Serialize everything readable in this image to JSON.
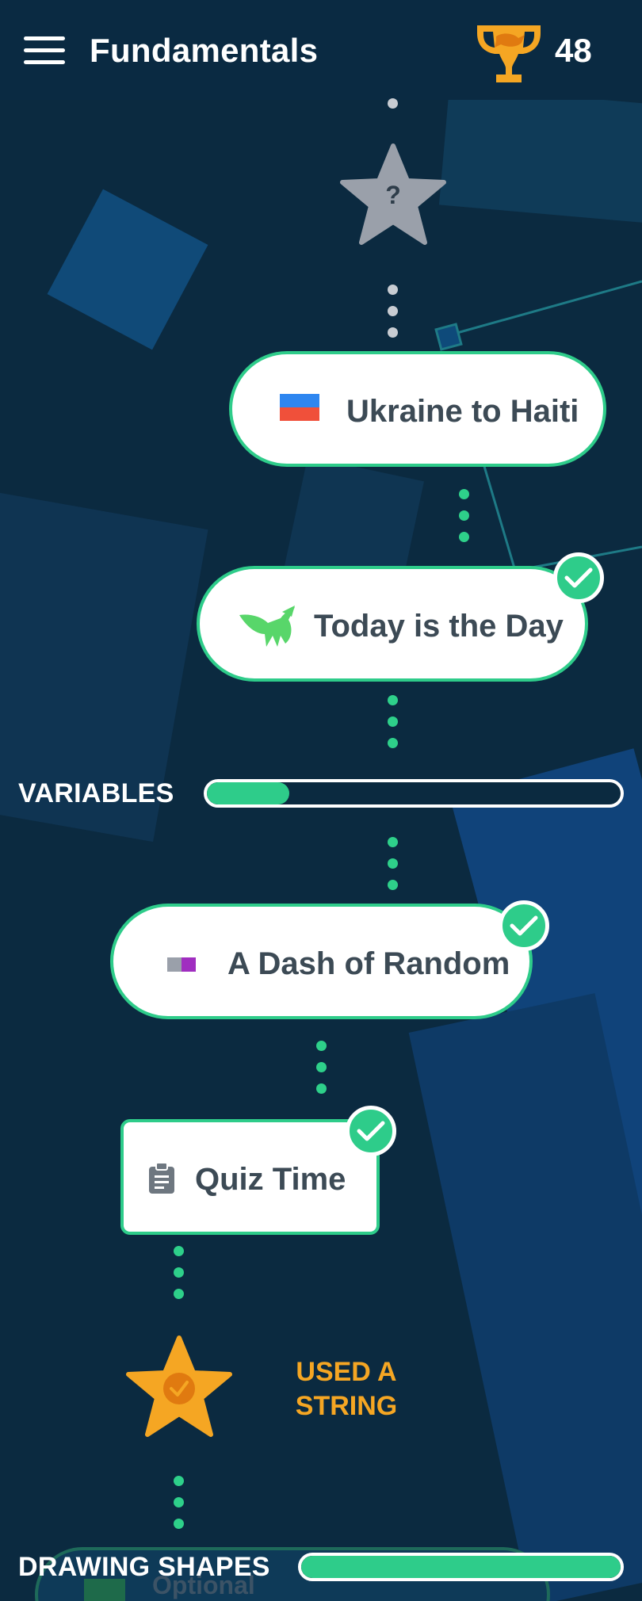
{
  "header": {
    "menu_icon": "hamburger-icon",
    "title": "Fundamentals",
    "trophy_icon": "trophy-icon",
    "score": "48"
  },
  "path": {
    "mystery_star": {
      "icon": "star-icon",
      "label": "?"
    },
    "lessons": [
      {
        "label": "Ukraine to Haiti",
        "icon": "flag-icon",
        "completed": false
      },
      {
        "label": "Today is the Day",
        "icon": "grasshopper-icon",
        "completed": true
      },
      {
        "label": "A Dash of Random",
        "icon": "color-swatch-icon",
        "completed": true
      },
      {
        "label": "Quiz Time",
        "icon": "clipboard-icon",
        "completed": true
      }
    ],
    "achievement": {
      "icon": "star-badge-icon",
      "label": "USED A STRING"
    },
    "optional": {
      "label": "Optional"
    }
  },
  "sections": [
    {
      "label": "VARIABLES",
      "progress": 0.2
    },
    {
      "label": "DRAWING SHAPES",
      "progress": 1.0
    }
  ],
  "colors": {
    "background": "#0b2a40",
    "accent_green": "#2ecc8a",
    "achievement_orange": "#f5a623",
    "trophy_gold": "#f5a623",
    "star_gray": "#9aa0aa"
  }
}
